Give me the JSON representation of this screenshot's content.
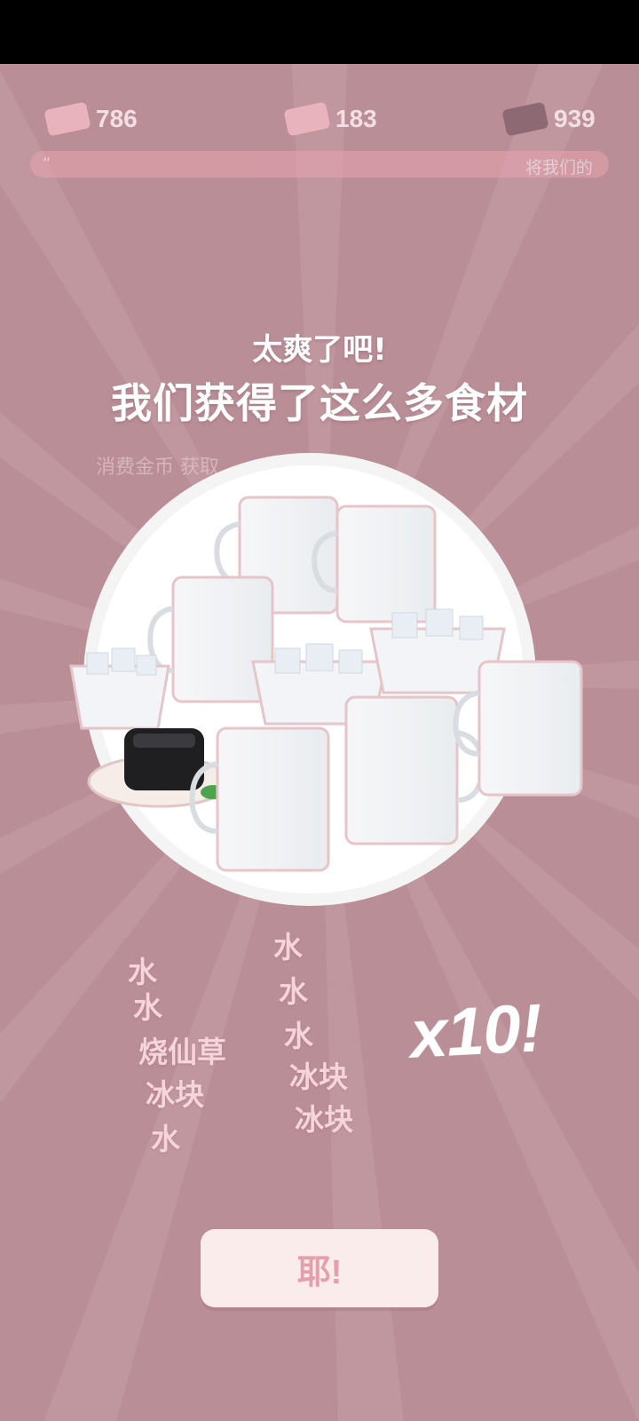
{
  "status_bar": {},
  "currencies": [
    {
      "icon": "ticket-card-icon",
      "value": "786"
    },
    {
      "icon": "coupon-card-icon",
      "value": "183"
    },
    {
      "icon": "plus-card-icon",
      "value": "939"
    }
  ],
  "progress": {
    "left_icon": "“",
    "label": "将我们的"
  },
  "underlying_text": "消费金币 获取",
  "popup": {
    "title_small": "太爽了吧!",
    "title_big": "我们获得了这么多食材",
    "items_left": [
      "水",
      "水",
      "烧仙草",
      "冰块",
      "水"
    ],
    "items_right": [
      "水",
      "水",
      "水",
      "冰块",
      "冰块"
    ],
    "multiplier": "x10!",
    "confirm_label": "耶!"
  },
  "colors": {
    "background": "#ba8e97",
    "accent": "#e59eaa",
    "text_pink": "#f6d4db"
  }
}
